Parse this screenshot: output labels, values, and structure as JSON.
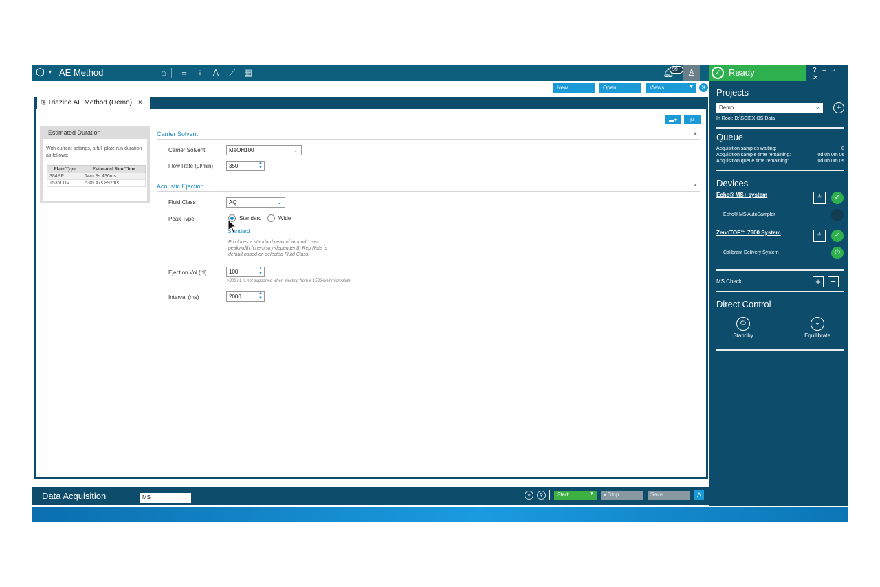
{
  "app": {
    "title": "AE Method",
    "notification_badge": "99+"
  },
  "status": {
    "label": "Ready",
    "window_controls": "? – ▫ ✕"
  },
  "toolbar": {
    "new_label": "New",
    "open_label": "Open...",
    "views_label": "Views"
  },
  "document": {
    "tab_label": "Triazine AE Method (Demo)",
    "tab_close": "×"
  },
  "estimated_duration": {
    "title": "Estimated Duration",
    "description": "With current settings, a full-plate run duration as follows:",
    "columns": [
      "Plate Type",
      "Estimated Run Time"
    ],
    "rows": [
      [
        "384PP",
        "14m 8s 436ms"
      ],
      [
        "1536LDV",
        "53m 47s 892ms"
      ]
    ]
  },
  "carrier_solvent": {
    "section_title": "Carrier Solvent",
    "solvent_label": "Carrier Solvent",
    "solvent_value": "MeOH100",
    "flow_label": "Flow Rate (µl/min)",
    "flow_value": "350"
  },
  "acoustic_ejection": {
    "section_title": "Acoustic Ejection",
    "fluid_label": "Fluid Class",
    "fluid_value": "AQ",
    "peak_label": "Peak Type",
    "peak_options": [
      "Standard",
      "Wide"
    ],
    "peak_selected": "Standard",
    "peak_subtitle": "Standard",
    "peak_description": "Produces a standard peak of around 1 sec peakwidth (chemistry-dependent). Rep Rate is default based on selected Fluid Class.",
    "ejection_label": "Ejection Vol (nl)",
    "ejection_value": "100",
    "ejection_hint": ">300 nL is not supported when ejecting from a 1536-well microplate",
    "interval_label": "Interval (ms)",
    "interval_value": "2000"
  },
  "projects": {
    "title": "Projects",
    "selected": "Demo",
    "root": "In Root: D:\\SCIEX OS Data"
  },
  "queue": {
    "title": "Queue",
    "items": [
      {
        "label": "Acquisition samples waiting:",
        "value": "0"
      },
      {
        "label": "Acquisition sample time remaining:",
        "value": "0d 0h 0m 0s"
      },
      {
        "label": "Acquisition queue time remaining:",
        "value": "0d 0h 0m 0s"
      }
    ]
  },
  "devices": {
    "title": "Devices",
    "echo_name": "Echo® MS+ system",
    "echo_sub": "Echo® MS AutoSampler",
    "zeno_name": "ZenoTOF™ 7600 System",
    "zeno_sub": "Calibrant Delivery System",
    "ms_check": "MS Check"
  },
  "direct_control": {
    "title": "Direct Control",
    "standby": "Standby",
    "equilibrate": "Equilibrate"
  },
  "bottom": {
    "title": "Data Acquisition",
    "ms_value": "MS",
    "start": "Start",
    "stop": "Stop",
    "save": "Save..."
  },
  "colors": {
    "brand_dark": "#0d4d6b",
    "accent": "#1a9ad6",
    "ready": "#2eb04f"
  }
}
